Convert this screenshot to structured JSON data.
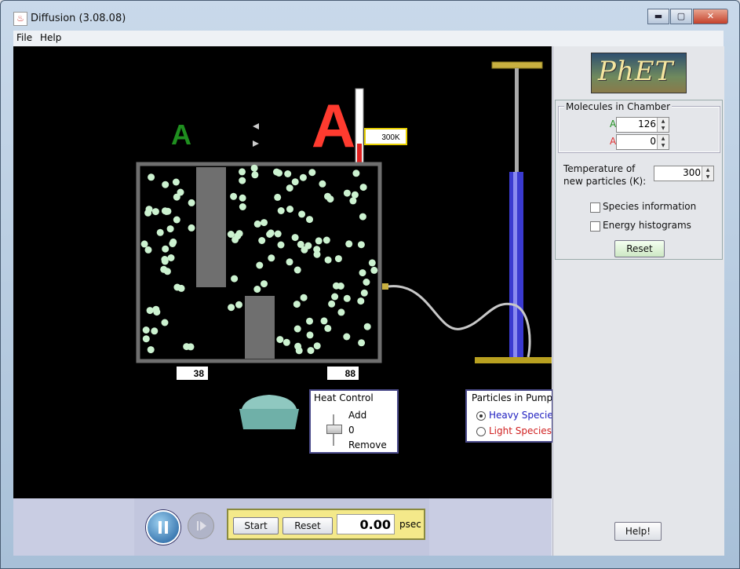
{
  "window": {
    "title": "Diffusion (3.08.08)",
    "min_label": "▬",
    "max_label": "▢",
    "close_label": "✕"
  },
  "menu": {
    "file": "File",
    "help": "Help"
  },
  "sim": {
    "species_a_label": "A",
    "species_a_red_label": "A",
    "thermometer_readout": "300K",
    "left_count": "38",
    "right_count": "88",
    "heat_control": {
      "title": "Heat Control",
      "add": "Add",
      "value": "0",
      "remove": "Remove"
    },
    "particles_in_pump": {
      "title": "Particles in Pump",
      "heavy": "Heavy Species",
      "light": "Light Species",
      "selected": "Heavy Species"
    },
    "colors": {
      "green": "#1f8f1f",
      "red": "#ff3b2f",
      "particle": "#ccf2d0",
      "pump_blue": "#3a3ad0",
      "gold": "#b8a020"
    }
  },
  "clock": {
    "start": "Start",
    "reset": "Reset",
    "time": "0.00",
    "unit": "psec"
  },
  "side": {
    "logo_text": "PhET",
    "molecules": {
      "title": "Molecules in Chamber",
      "a_label": "A",
      "a_value": "126",
      "b_label": "A",
      "b_value": "0"
    },
    "temperature": {
      "label_line1": "Temperature of",
      "label_line2": "new particles (K):",
      "value": "300"
    },
    "species_info": "Species information",
    "energy_histograms": "Energy histograms",
    "reset": "Reset",
    "help": "Help!"
  }
}
